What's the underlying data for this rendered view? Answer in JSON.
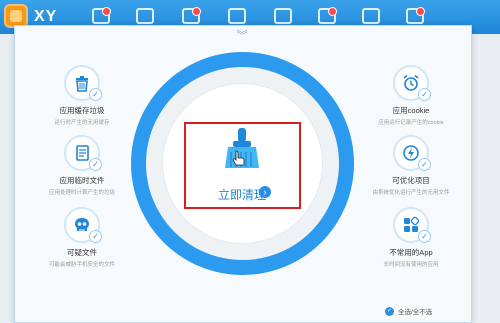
{
  "app": {
    "brand": "XY"
  },
  "clean": {
    "label": "立即清理",
    "arrow": "›"
  },
  "items": [
    {
      "title": "应用缓存垃圾",
      "desc": "运行时产生的无用缓存"
    },
    {
      "title": "应用临时文件",
      "desc": "应用处理时计算产生的垃圾"
    },
    {
      "title": "可疑文件",
      "desc": "可能会威胁手机安全的文件"
    },
    {
      "title": "应用cookie",
      "desc": "应用运行记录产生的cookie"
    },
    {
      "title": "可优化项目",
      "desc": "由系统优化运行产生的无用文件"
    },
    {
      "title": "不常用的App",
      "desc": "长时间没有使用的应用"
    }
  ],
  "footer": {
    "label": "全选/全不选"
  },
  "colors": {
    "accent": "#2c9bef",
    "highlight": "#d61f1f"
  }
}
